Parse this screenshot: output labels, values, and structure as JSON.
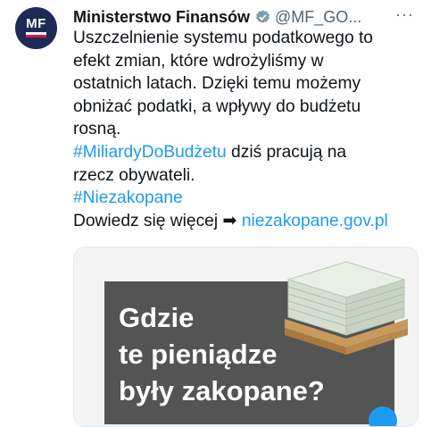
{
  "account": {
    "avatar_text": "MF",
    "name": "Ministerstwo Finansów",
    "handle": "@MF_GO...",
    "more": "···"
  },
  "tweet": {
    "lines": [
      "Uszczelnienie systemu podatkowego to",
      "efekt zmian, które wdrożyliśmy w",
      "ostatnich latach. Dzięki temu możemy",
      "obniżać podatki, a wpływy do budżetu",
      "rosną."
    ],
    "hashtag1": "#MiliardyDoBudżetu",
    "line6_rest": " dziś pracują na",
    "line7": "rzecz obywateli.",
    "hashtag2": "#Niezakopane",
    "more_prefix": "Dowiedz się więcej ➡ ",
    "link": "niezakopane.gov.pl"
  },
  "card": {
    "banner_lines": [
      "Gdzie",
      "te pieniądze",
      "były zakopane?"
    ]
  },
  "colors": {
    "link": "#1d9bf0",
    "avatar_bg": "#1c2a55",
    "banner_bg": "#545454"
  }
}
